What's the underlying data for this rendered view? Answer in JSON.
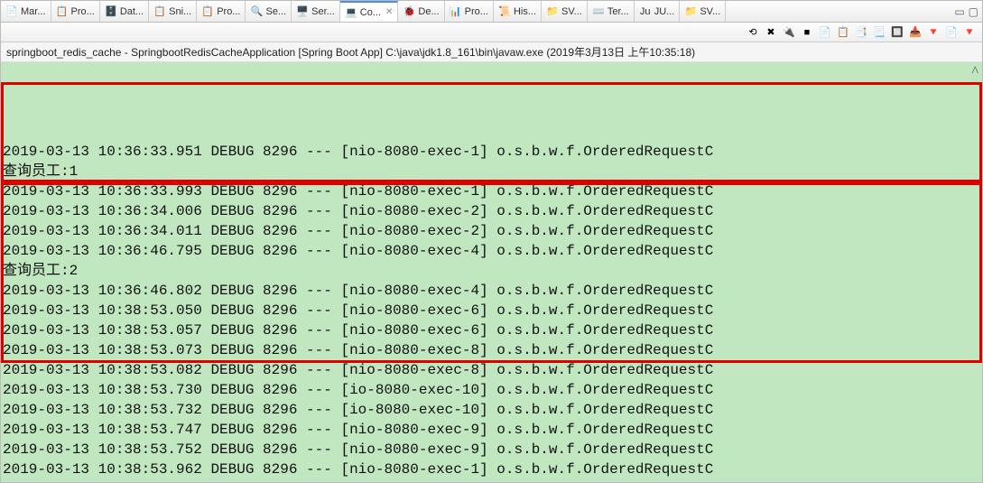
{
  "tabs": [
    {
      "icon": "📄",
      "label": "Mar..."
    },
    {
      "icon": "📋",
      "label": "Pro..."
    },
    {
      "icon": "🗄️",
      "label": "Dat..."
    },
    {
      "icon": "📋",
      "label": "Sni..."
    },
    {
      "icon": "📋",
      "label": "Pro..."
    },
    {
      "icon": "🔍",
      "label": "Se..."
    },
    {
      "icon": "🖥️",
      "label": "Ser..."
    },
    {
      "icon": "💻",
      "label": "Co...",
      "active": true,
      "close": true
    },
    {
      "icon": "🐞",
      "label": "De..."
    },
    {
      "icon": "📊",
      "label": "Pro..."
    },
    {
      "icon": "📜",
      "label": "His..."
    },
    {
      "icon": "📁",
      "label": "SV..."
    },
    {
      "icon": "⌨️",
      "label": "Ter..."
    },
    {
      "icon": "Ju",
      "label": "JU..."
    },
    {
      "icon": "📁",
      "label": "SV..."
    }
  ],
  "window": {
    "min": "▭",
    "max": "▢"
  },
  "toolbar_icons": [
    "⟲",
    "✖",
    "🔌",
    "■",
    "📄",
    "📋",
    "📑",
    "📃",
    "🔲",
    "📥",
    "🔻",
    "📄",
    "🔻"
  ],
  "description": "springboot_redis_cache - SpringbootRedisCacheApplication [Spring Boot App] C:\\java\\jdk1.8_161\\bin\\javaw.exe (2019年3月13日 上午10:35:18)",
  "log": [
    "2019-03-13 10:36:33.951 DEBUG 8296 --- [nio-8080-exec-1] o.s.b.w.f.OrderedRequestC",
    "查询员工:1",
    "2019-03-13 10:36:33.993 DEBUG 8296 --- [nio-8080-exec-1] o.s.b.w.f.OrderedRequestC",
    "2019-03-13 10:36:34.006 DEBUG 8296 --- [nio-8080-exec-2] o.s.b.w.f.OrderedRequestC",
    "2019-03-13 10:36:34.011 DEBUG 8296 --- [nio-8080-exec-2] o.s.b.w.f.OrderedRequestC",
    "2019-03-13 10:36:46.795 DEBUG 8296 --- [nio-8080-exec-4] o.s.b.w.f.OrderedRequestC",
    "查询员工:2",
    "2019-03-13 10:36:46.802 DEBUG 8296 --- [nio-8080-exec-4] o.s.b.w.f.OrderedRequestC",
    "2019-03-13 10:38:53.050 DEBUG 8296 --- [nio-8080-exec-6] o.s.b.w.f.OrderedRequestC",
    "2019-03-13 10:38:53.057 DEBUG 8296 --- [nio-8080-exec-6] o.s.b.w.f.OrderedRequestC",
    "2019-03-13 10:38:53.073 DEBUG 8296 --- [nio-8080-exec-8] o.s.b.w.f.OrderedRequestC",
    "2019-03-13 10:38:53.082 DEBUG 8296 --- [nio-8080-exec-8] o.s.b.w.f.OrderedRequestC",
    "2019-03-13 10:38:53.730 DEBUG 8296 --- [io-8080-exec-10] o.s.b.w.f.OrderedRequestC",
    "2019-03-13 10:38:53.732 DEBUG 8296 --- [io-8080-exec-10] o.s.b.w.f.OrderedRequestC",
    "2019-03-13 10:38:53.747 DEBUG 8296 --- [nio-8080-exec-9] o.s.b.w.f.OrderedRequestC",
    "2019-03-13 10:38:53.752 DEBUG 8296 --- [nio-8080-exec-9] o.s.b.w.f.OrderedRequestC",
    "2019-03-13 10:38:53.962 DEBUG 8296 --- [nio-8080-exec-1] o.s.b.w.f.OrderedRequestC"
  ],
  "caret": "^"
}
